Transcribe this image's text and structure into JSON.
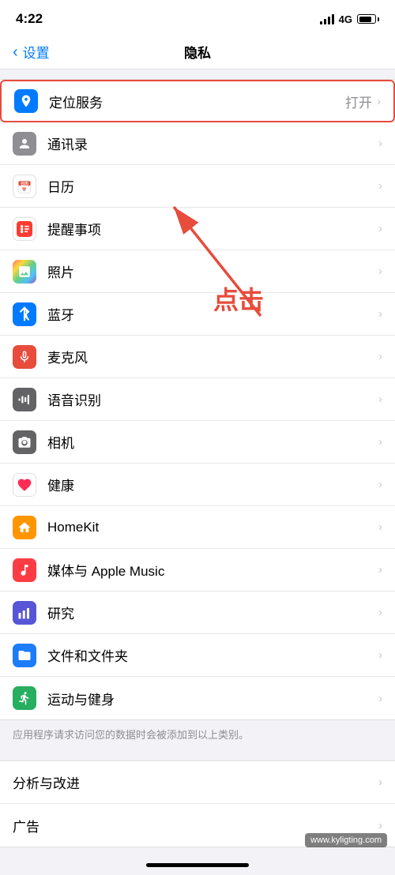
{
  "statusBar": {
    "time": "4:22",
    "signal": "4G",
    "batteryLevel": 80
  },
  "navBar": {
    "backLabel": "设置",
    "title": "隐私"
  },
  "annotation": {
    "clickText": "点击",
    "arrowColor": "#e74c3c"
  },
  "items": [
    {
      "id": "location",
      "label": "定位服务",
      "status": "打开",
      "iconBg": "#007aff",
      "iconSymbol": "◀",
      "highlighted": true
    },
    {
      "id": "contacts",
      "label": "通讯录",
      "status": "",
      "iconBg": "#8e8e93",
      "iconSymbol": "👤",
      "highlighted": false
    },
    {
      "id": "calendar",
      "label": "日历",
      "status": "",
      "iconBg": "#ff3b30",
      "iconSymbol": "📅",
      "highlighted": false
    },
    {
      "id": "reminders",
      "label": "提醒事项",
      "status": "",
      "iconBg": "#ff3b30",
      "iconSymbol": "⚫",
      "highlighted": false
    },
    {
      "id": "photos",
      "label": "照片",
      "status": "",
      "iconBg": "#e8e8e8",
      "iconSymbol": "🌸",
      "highlighted": false
    },
    {
      "id": "bluetooth",
      "label": "蓝牙",
      "status": "",
      "iconBg": "#007aff",
      "iconSymbol": "✦",
      "highlighted": false
    },
    {
      "id": "microphone",
      "label": "麦克风",
      "status": "",
      "iconBg": "#e74c3c",
      "iconSymbol": "🎤",
      "highlighted": false
    },
    {
      "id": "speech",
      "label": "语音识别",
      "status": "",
      "iconBg": "#636366",
      "iconSymbol": "📊",
      "highlighted": false
    },
    {
      "id": "camera",
      "label": "相机",
      "status": "",
      "iconBg": "#636366",
      "iconSymbol": "📷",
      "highlighted": false
    },
    {
      "id": "health",
      "label": "健康",
      "status": "",
      "iconBg": "#ff2d55",
      "iconSymbol": "♥",
      "highlighted": false
    },
    {
      "id": "homekit",
      "label": "HomeKit",
      "status": "",
      "iconBg": "#ff9500",
      "iconSymbol": "🏠",
      "highlighted": false
    },
    {
      "id": "music",
      "label": "媒体与 Apple Music",
      "status": "",
      "iconBg": "#fc3c44",
      "iconSymbol": "♪",
      "highlighted": false
    },
    {
      "id": "research",
      "label": "研究",
      "status": "",
      "iconBg": "#5856d6",
      "iconSymbol": "📊",
      "highlighted": false
    },
    {
      "id": "files",
      "label": "文件和文件夹",
      "status": "",
      "iconBg": "#1c7cf9",
      "iconSymbol": "📁",
      "highlighted": false
    },
    {
      "id": "fitness",
      "label": "运动与健身",
      "status": "",
      "iconBg": "#27ae60",
      "iconSymbol": "🏃",
      "highlighted": false
    }
  ],
  "footerNote": "应用程序请求访问您的数据时会被添加到以上类别。",
  "section2": [
    {
      "id": "analytics",
      "label": "分析与改进",
      "status": "",
      "iconBg": null,
      "highlighted": false
    },
    {
      "id": "ads",
      "label": "广告",
      "status": "",
      "iconBg": null,
      "highlighted": false
    }
  ],
  "watermark": "www.kyligting.com"
}
